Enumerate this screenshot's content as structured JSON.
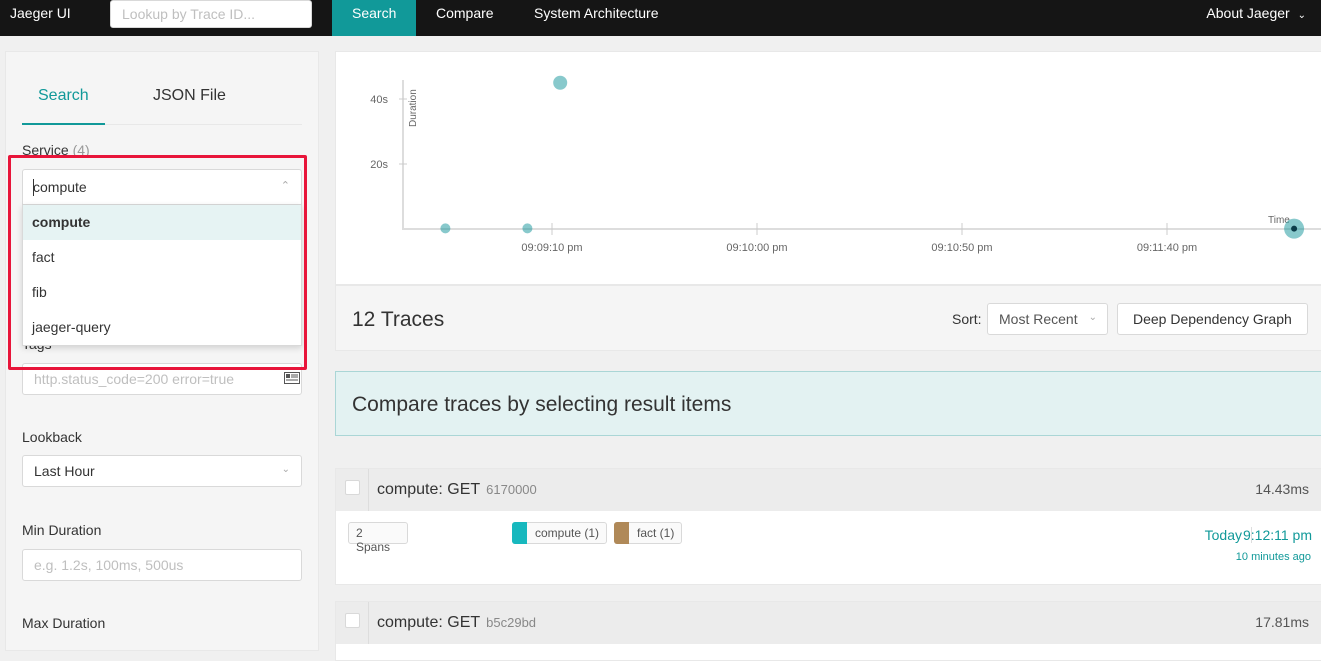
{
  "nav": {
    "brand": "Jaeger UI",
    "lookup_placeholder": "Lookup by Trace ID...",
    "tabs": [
      "Search",
      "Compare",
      "System Architecture"
    ],
    "about": "About Jaeger"
  },
  "sidebar": {
    "tabs": [
      "Search",
      "JSON File"
    ],
    "service_label": "Service",
    "service_count": "(4)",
    "service_value": "compute",
    "service_options": [
      "compute",
      "fact",
      "fib",
      "jaeger-query"
    ],
    "tags_label": "Tags",
    "tags_placeholder": "http.status_code=200 error=true",
    "lookback_label": "Lookback",
    "lookback_value": "Last Hour",
    "min_duration_label": "Min Duration",
    "min_duration_placeholder": "e.g. 1.2s, 100ms, 500us",
    "max_duration_label": "Max Duration"
  },
  "chart_data": {
    "type": "scatter",
    "xlabel": "Time",
    "ylabel": "Duration",
    "y_ticks": [
      "20s",
      "40s"
    ],
    "x_ticks": [
      "09:09:10 pm",
      "09:10:00 pm",
      "09:10:50 pm",
      "09:11:40 pm"
    ],
    "points": [
      {
        "x": "09:08:44 pm",
        "y": 0.2
      },
      {
        "x": "09:09:04 pm",
        "y": 0.2
      },
      {
        "x": "09:09:12 pm",
        "y": 45
      },
      {
        "x": "09:12:11 pm",
        "y": 0.1
      }
    ]
  },
  "results": {
    "count": "12 Traces",
    "sort_label": "Sort:",
    "sort_value": "Most Recent",
    "ddg_button": "Deep Dependency Graph",
    "compare_banner": "Compare traces by selecting result items",
    "traces": [
      {
        "title": "compute: GET",
        "id": "6170000",
        "duration": "14.43ms",
        "spans": "2 Spans",
        "services": [
          {
            "name": "compute (1)",
            "color": "#17b8be"
          },
          {
            "name": "fact (1)",
            "color": "#b08958"
          }
        ],
        "day": "Today",
        "time": "9:12:11 pm",
        "ago": "10 minutes ago"
      },
      {
        "title": "compute: GET",
        "id": "b5c29bd",
        "duration": "17.81ms"
      }
    ]
  },
  "colors": {
    "accent": "#119999",
    "highlight": "#e8153a"
  }
}
